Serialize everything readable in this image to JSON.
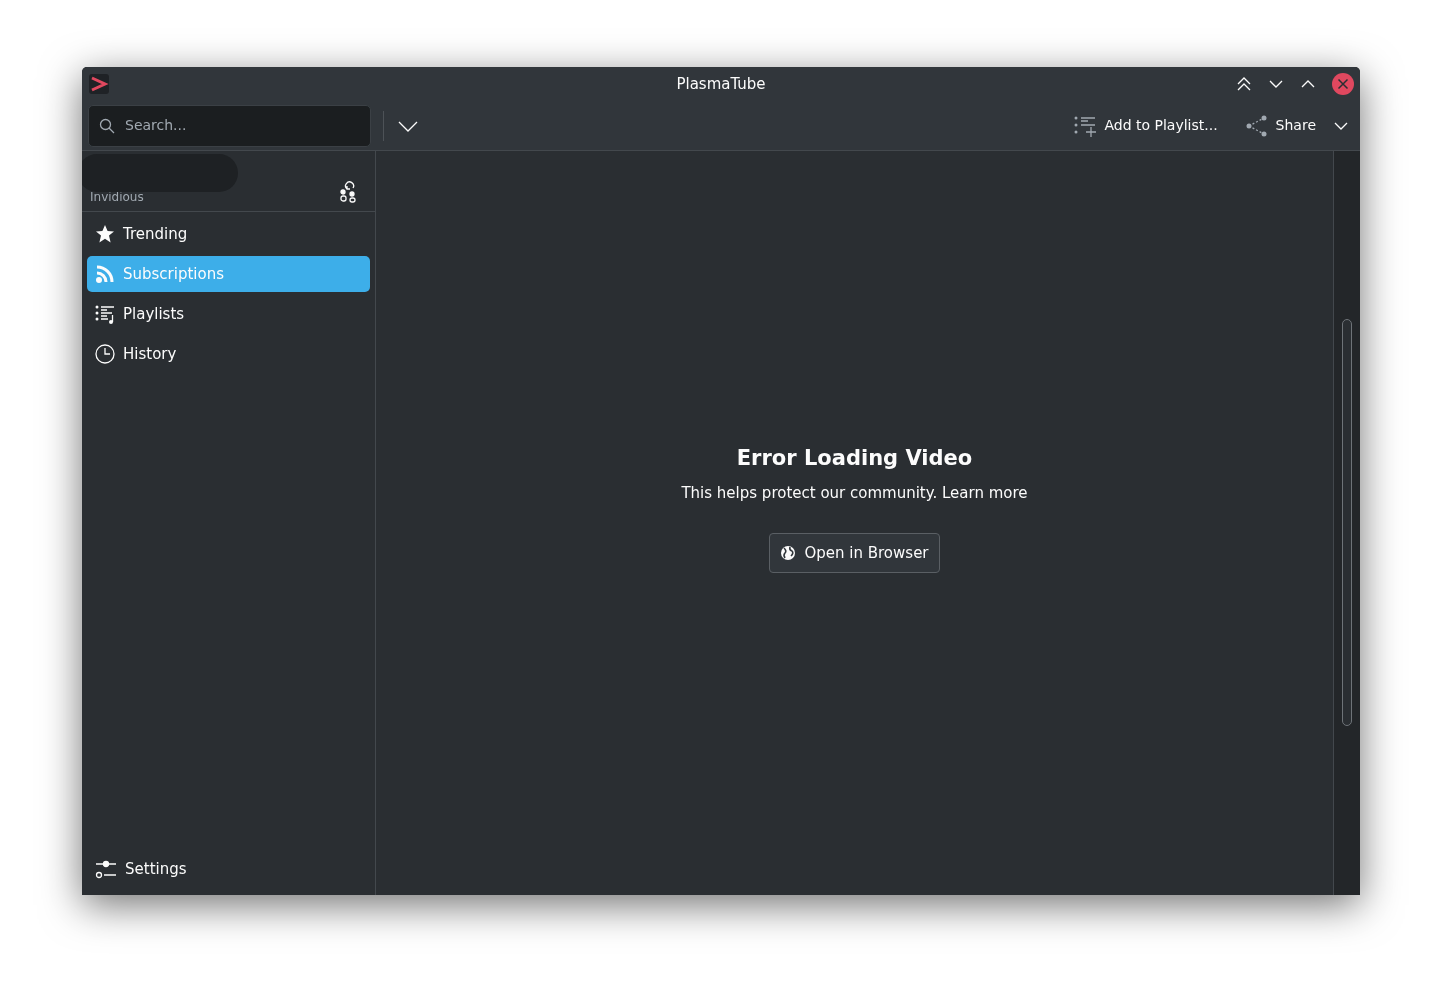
{
  "window": {
    "title": "PlasmaTube"
  },
  "toolbar": {
    "search": {
      "placeholder": "Search..."
    },
    "actions": [
      {
        "label": "Add to Playlist...",
        "kind": "playlist",
        "dropdown": false
      },
      {
        "label": "Share",
        "kind": "share",
        "dropdown": true
      }
    ]
  },
  "sidebar": {
    "header": "Invidious",
    "items": [
      {
        "label": "Trending",
        "kind": "star",
        "selected": false
      },
      {
        "label": "Subscriptions",
        "kind": "feed",
        "selected": true
      },
      {
        "label": "Playlists",
        "kind": "playlist",
        "selected": false
      },
      {
        "label": "History",
        "kind": "clock",
        "selected": false
      }
    ],
    "footer": {
      "label": "Settings"
    }
  },
  "content": {
    "title": "Error Loading Video",
    "message": "This helps protect our community. Learn more",
    "button": "Open in Browser"
  }
}
